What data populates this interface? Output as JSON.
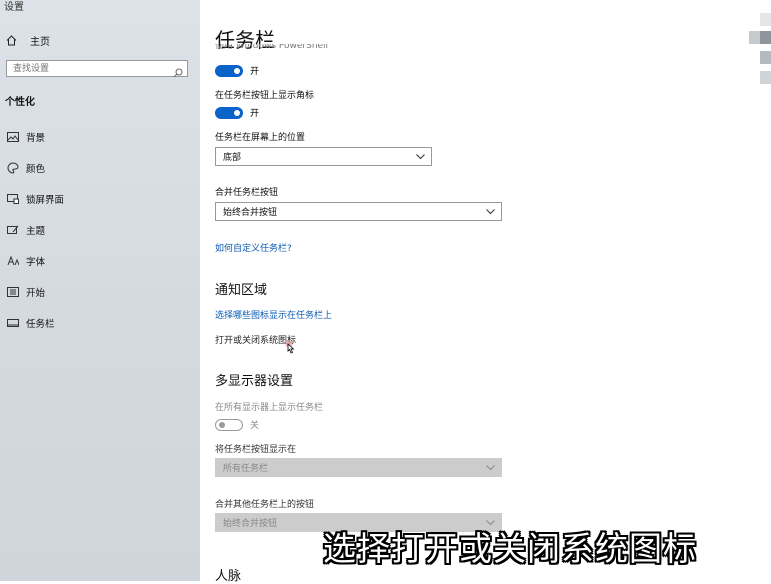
{
  "sidebar": {
    "app_title": "设置",
    "home_label": "主页",
    "search_placeholder": "查找设置",
    "section_title": "个性化",
    "items": [
      {
        "label": "背景",
        "icon": "image-icon"
      },
      {
        "label": "颜色",
        "icon": "palette-icon"
      },
      {
        "label": "锁屏界面",
        "icon": "lock-screen-icon"
      },
      {
        "label": "主题",
        "icon": "theme-icon"
      },
      {
        "label": "字体",
        "icon": "font-icon"
      },
      {
        "label": "开始",
        "icon": "start-icon"
      },
      {
        "label": "任务栏",
        "icon": "taskbar-icon"
      }
    ]
  },
  "main": {
    "page_title": "任务栏",
    "cut_text": "使用 Windows PowerShell",
    "toggle1_state": "开",
    "badges_label": "在任务栏按钮上显示角标",
    "toggle2_state": "开",
    "position_label": "任务栏在屏幕上的位置",
    "position_value": "底部",
    "combine_label": "合并任务栏按钮",
    "combine_value": "始终合并按钮",
    "customize_link": "如何自定义任务栏?",
    "notification_heading": "通知区域",
    "select_icons_link": "选择哪些图标显示在任务栏上",
    "system_icons_link": "打开或关闭系统图标",
    "multi_display_heading": "多显示器设置",
    "show_all_displays_label": "在所有显示器上显示任务栏",
    "toggle3_state": "关",
    "show_buttons_on_label": "将任务栏按钮显示在",
    "show_buttons_on_value": "所有任务栏",
    "combine_other_label": "合并其他任务栏上的按钮",
    "combine_other_value": "始终合并按钮",
    "people_heading": "人脉"
  },
  "caption": "选择打开或关闭系统图标",
  "colors": {
    "accent": "#0a63c9",
    "link": "#0a5bb5",
    "sidebar_bg": "#d6dce2"
  }
}
